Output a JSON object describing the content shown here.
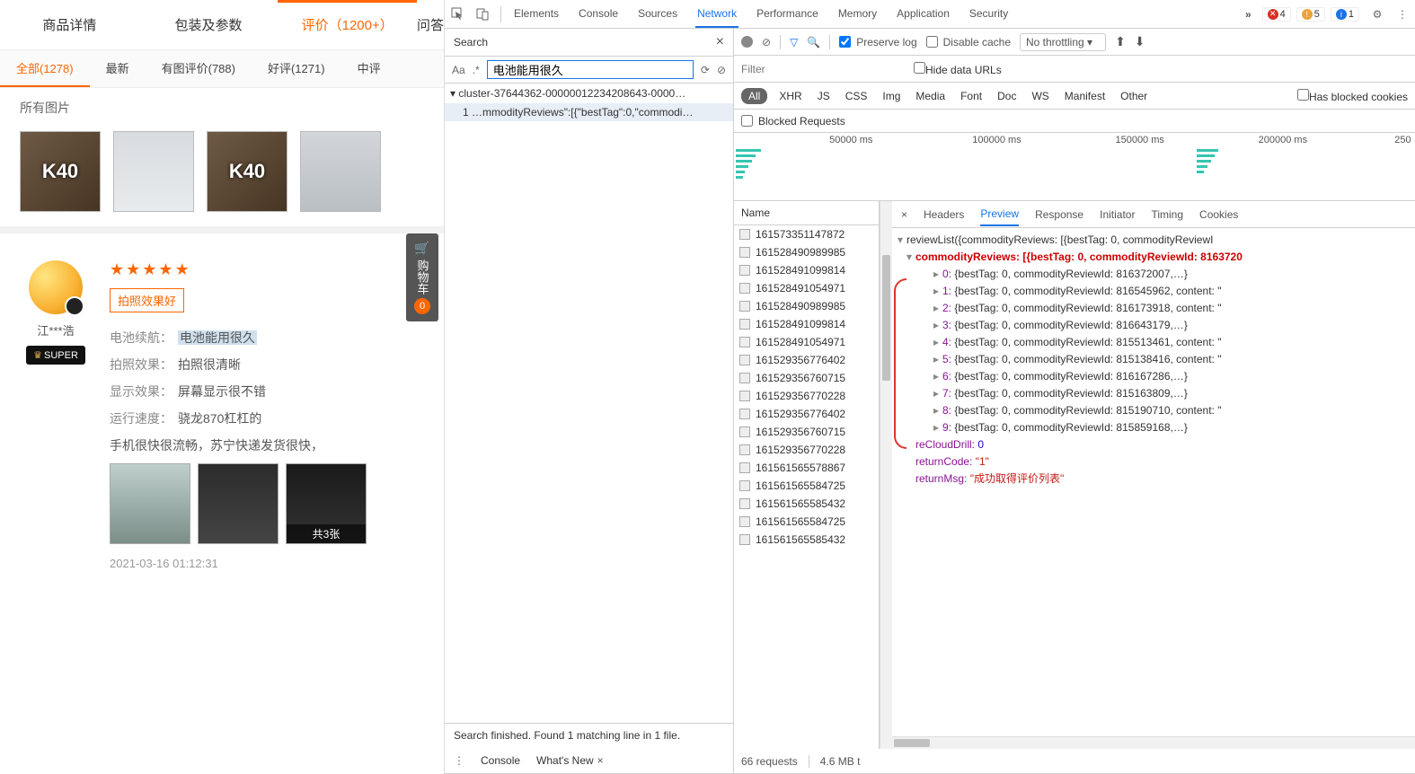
{
  "page": {
    "topTabs": [
      "商品详情",
      "包装及参数",
      "评价（1200+）",
      "问答"
    ],
    "subTabs": [
      {
        "label": "全部(1278)",
        "active": true
      },
      {
        "label": "最新"
      },
      {
        "label": "有图评价(788)"
      },
      {
        "label": "好评(1271)"
      },
      {
        "label": "中评"
      }
    ],
    "allPicsLabel": "所有图片",
    "cart": {
      "label": "购物车",
      "badge": "0"
    },
    "review": {
      "username": "江***浩",
      "badge": "SUPER",
      "stars": 5,
      "tag": "拍照效果好",
      "lines": [
        {
          "label": "电池续航：",
          "value": "电池能用很久",
          "hl": true
        },
        {
          "label": "拍照效果：",
          "value": "拍照很清晰"
        },
        {
          "label": "显示效果：",
          "value": "屏幕显示很不错"
        },
        {
          "label": "运行速度：",
          "value": "骁龙870杠杠的"
        }
      ],
      "extra": "手机很快很流畅，苏宁快递发货很快，",
      "picCap": "共3张",
      "time": "2021-03-16 01:12:31"
    }
  },
  "devtools": {
    "tabs": [
      "Elements",
      "Console",
      "Sources",
      "Network",
      "Performance",
      "Memory",
      "Application",
      "Security"
    ],
    "activeTab": "Network",
    "errors": {
      "err": "4",
      "warn": "5",
      "info": "1"
    },
    "search": {
      "title": "Search",
      "value": "电池能用很久",
      "group": "▾ cluster-37644362-00000012234208643-0000…",
      "row": "1   …mmodityReviews\":[{\"bestTag\":0,\"commodi…",
      "foot": "Search finished.  Found 1 matching line in 1 file."
    },
    "net": {
      "preserve": "Preserve log",
      "disable": "Disable cache",
      "thr": "No throttling",
      "filterPlaceholder": "Filter",
      "hideUrls": "Hide data URLs",
      "types": [
        "All",
        "XHR",
        "JS",
        "CSS",
        "Img",
        "Media",
        "Font",
        "Doc",
        "WS",
        "Manifest",
        "Other"
      ],
      "blockedChk": "Has blocked cookies",
      "blockedReq": "Blocked Requests",
      "ticks": [
        "50000 ms",
        "100000 ms",
        "150000 ms",
        "200000 ms",
        "250"
      ],
      "nameHdr": "Name",
      "names": [
        "161573351147872",
        "161528490989985",
        "161528491099814",
        "161528491054971",
        "161528490989985",
        "161528491099814",
        "161528491054971",
        "161529356776402",
        "161529356760715",
        "161529356770228",
        "161529356776402",
        "161529356760715",
        "161529356770228",
        "161561565578867",
        "161561565584725",
        "161561565585432",
        "161561565584725",
        "161561565585432"
      ],
      "status": {
        "reqs": "66 requests",
        "size": "4.6 MB t"
      }
    },
    "detail": {
      "tabs": [
        "Headers",
        "Preview",
        "Response",
        "Initiator",
        "Timing",
        "Cookies"
      ],
      "active": "Preview",
      "preview": {
        "root": "reviewList({commodityReviews: [{bestTag: 0, commodityReviewI",
        "cr": "commodityReviews: [{bestTag: 0, commodityReviewId: 8163720",
        "items": [
          "{bestTag: 0, commodityReviewId: 816372007,…}",
          "{bestTag: 0, commodityReviewId: 816545962, content: \"",
          "{bestTag: 0, commodityReviewId: 816173918, content: \"",
          "{bestTag: 0, commodityReviewId: 816643179,…}",
          "{bestTag: 0, commodityReviewId: 815513461, content: \"",
          "{bestTag: 0, commodityReviewId: 815138416, content: \"",
          "{bestTag: 0, commodityReviewId: 816167286,…}",
          "{bestTag: 0, commodityReviewId: 815163809,…}",
          "{bestTag: 0, commodityReviewId: 815190710, content: \"",
          "{bestTag: 0, commodityReviewId: 815859168,…}"
        ],
        "reCloud": "reCloudDrill: ",
        "reCloudV": "0",
        "retCode": "returnCode: ",
        "retCodeV": "\"1\"",
        "retMsg": "returnMsg: ",
        "retMsgV": "\"成功取得评价列表\""
      }
    },
    "drawer": {
      "tabs": [
        "Console",
        "What's New"
      ]
    }
  }
}
